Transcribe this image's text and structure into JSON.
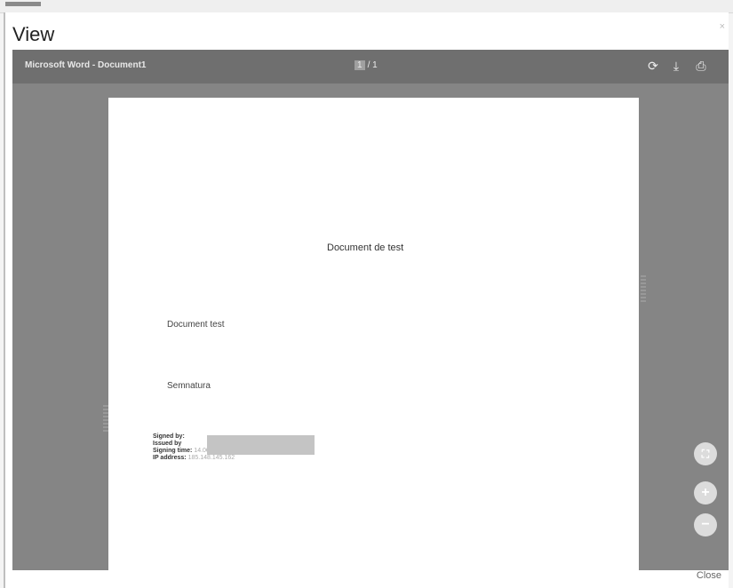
{
  "window": {
    "title": "View",
    "close_icon": "×",
    "close_label": "Close"
  },
  "viewer": {
    "doc_title": "Microsoft Word - Document1",
    "page_current": "1",
    "page_total": "/ 1",
    "icons": [
      "rotate-icon",
      "download-icon",
      "print-icon"
    ]
  },
  "page": {
    "heading": "Document de test",
    "line1": "Document test",
    "line2": "Semnatura",
    "signature": {
      "signed_by_label": "Signed by:",
      "issued_by_label": "Issued by",
      "signing_time_label": "Signing time:",
      "signing_time_value": "14.06.2022 07:52:14",
      "ip_label": "IP address:",
      "ip_value": "185.148.145.162"
    }
  },
  "zoom": {
    "fit_label": "⛶",
    "zoom_in_label": "+",
    "zoom_out_label": "−"
  }
}
